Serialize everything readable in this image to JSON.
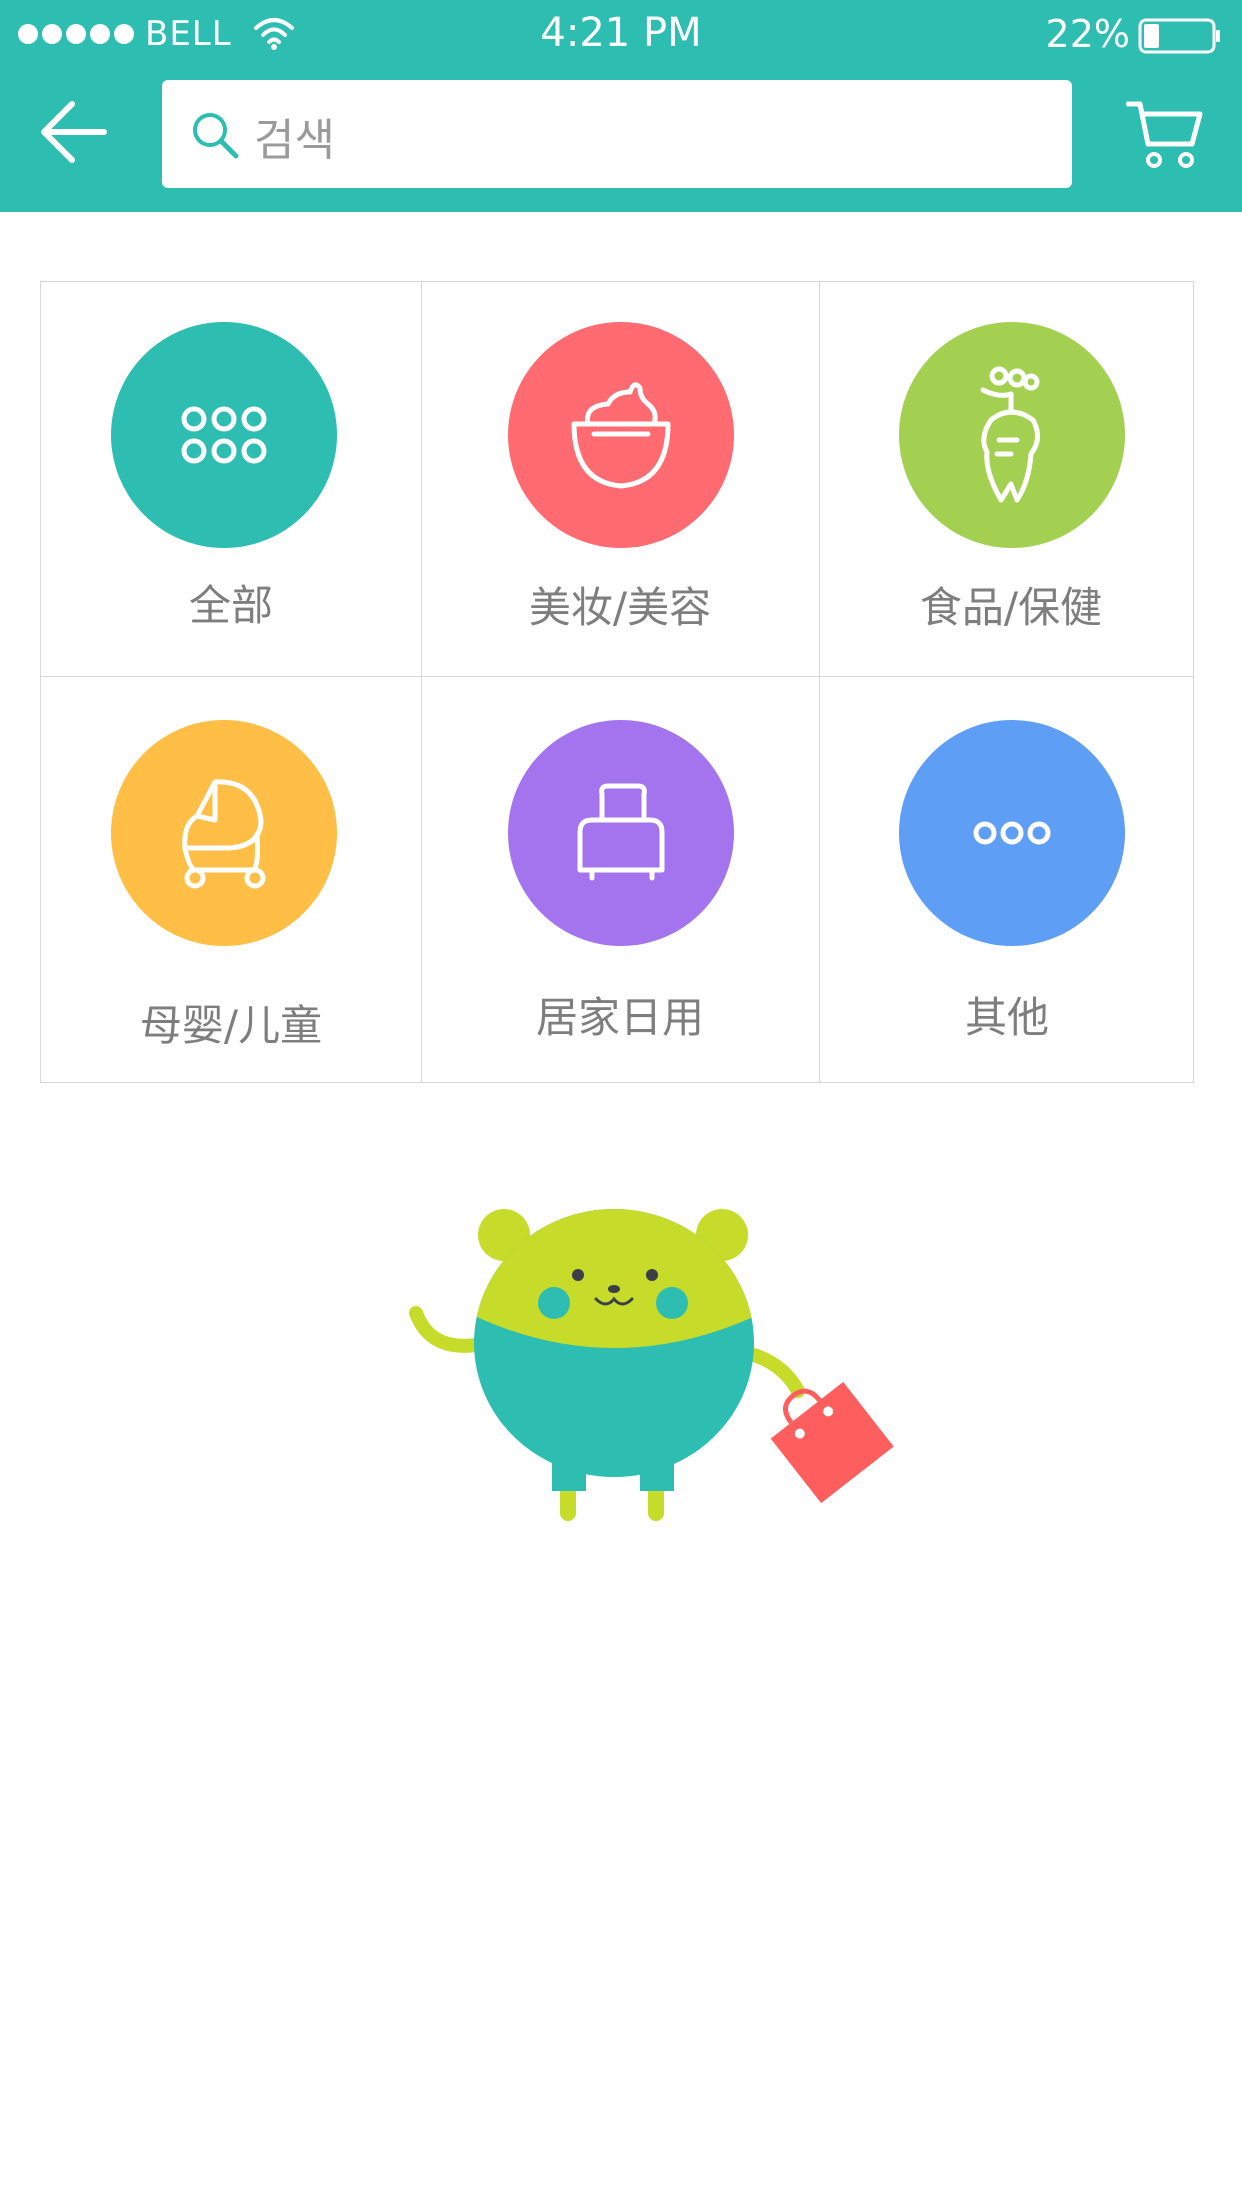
{
  "status_bar": {
    "carrier": "BELL",
    "time": "4:21 PM",
    "battery": "22%",
    "battery_level": 0.22
  },
  "header": {
    "search_placeholder": "검색"
  },
  "categories": [
    {
      "label": "全部",
      "icon": "grid-dots-icon",
      "color": "#2dbdb1"
    },
    {
      "label": "美妆/美容",
      "icon": "cream-jar-icon",
      "color": "#ff6b70"
    },
    {
      "label": "食品/保健",
      "icon": "radish-icon",
      "color": "#a4d052"
    },
    {
      "label": "母婴/儿童",
      "icon": "stroller-icon",
      "color": "#ffbe45"
    },
    {
      "label": "居家日用",
      "icon": "toaster-icon",
      "color": "#a474ee"
    },
    {
      "label": "其他",
      "icon": "more-dots-icon",
      "color": "#5f9ef5"
    }
  ],
  "colors": {
    "header": "#2dbdb1",
    "mascot_head": "#c7db2a",
    "mascot_body": "#2dbdb1",
    "bag": "#ff5e5e"
  }
}
